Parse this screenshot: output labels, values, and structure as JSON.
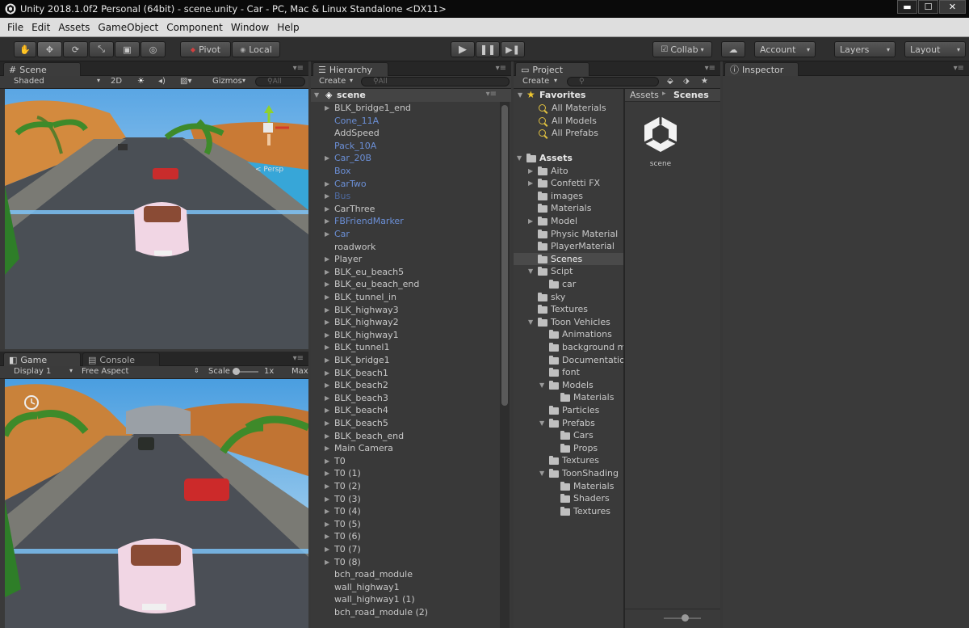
{
  "window": {
    "title": "Unity 2018.1.0f2 Personal (64bit) - scene.unity - Car - PC, Mac & Linux Standalone <DX11>"
  },
  "menu": [
    "File",
    "Edit",
    "Assets",
    "GameObject",
    "Component",
    "Window",
    "Help"
  ],
  "toolbar": {
    "pivot": "Pivot",
    "local": "Local",
    "collab": "Collab",
    "account": "Account",
    "layers": "Layers",
    "layout": "Layout"
  },
  "scene": {
    "tab": "Scene",
    "shading": "Shaded",
    "mode2d": "2D",
    "gizmos": "Gizmos",
    "search_placeholder": "All",
    "persp": "< Persp"
  },
  "game": {
    "tab": "Game",
    "console_tab": "Console",
    "display": "Display 1",
    "aspect": "Free Aspect",
    "scale_label": "Scale",
    "scale_value": "1x",
    "maximize": "Max"
  },
  "hierarchy": {
    "tab": "Hierarchy",
    "create": "Create",
    "search_placeholder": "All",
    "root": "scene",
    "items": [
      {
        "label": "BLK_bridge1_end",
        "arrow": true,
        "style": "normal"
      },
      {
        "label": "Cone_11A",
        "arrow": false,
        "style": "prefab"
      },
      {
        "label": "AddSpeed",
        "arrow": false,
        "style": "normal"
      },
      {
        "label": "Pack_10A",
        "arrow": false,
        "style": "prefab"
      },
      {
        "label": "Car_20B",
        "arrow": true,
        "style": "prefab"
      },
      {
        "label": "Box",
        "arrow": false,
        "style": "prefab"
      },
      {
        "label": "CarTwo",
        "arrow": true,
        "style": "prefab"
      },
      {
        "label": "Bus",
        "arrow": true,
        "style": "prefab-dim"
      },
      {
        "label": "CarThree",
        "arrow": true,
        "style": "normal"
      },
      {
        "label": "FBFriendMarker",
        "arrow": true,
        "style": "prefab"
      },
      {
        "label": "Car",
        "arrow": true,
        "style": "prefab"
      },
      {
        "label": "roadwork",
        "arrow": false,
        "style": "normal"
      },
      {
        "label": "Player",
        "arrow": true,
        "style": "normal"
      },
      {
        "label": "BLK_eu_beach5",
        "arrow": true,
        "style": "normal"
      },
      {
        "label": "BLK_eu_beach_end",
        "arrow": true,
        "style": "normal"
      },
      {
        "label": "BLK_tunnel_in",
        "arrow": true,
        "style": "normal"
      },
      {
        "label": "BLK_highway3",
        "arrow": true,
        "style": "normal"
      },
      {
        "label": "BLK_highway2",
        "arrow": true,
        "style": "normal"
      },
      {
        "label": "BLK_highway1",
        "arrow": true,
        "style": "normal"
      },
      {
        "label": "BLK_tunnel1",
        "arrow": true,
        "style": "normal"
      },
      {
        "label": "BLK_bridge1",
        "arrow": true,
        "style": "normal"
      },
      {
        "label": "BLK_beach1",
        "arrow": true,
        "style": "normal"
      },
      {
        "label": "BLK_beach2",
        "arrow": true,
        "style": "normal"
      },
      {
        "label": "BLK_beach3",
        "arrow": true,
        "style": "normal"
      },
      {
        "label": "BLK_beach4",
        "arrow": true,
        "style": "normal"
      },
      {
        "label": "BLK_beach5",
        "arrow": true,
        "style": "normal"
      },
      {
        "label": "BLK_beach_end",
        "arrow": true,
        "style": "normal"
      },
      {
        "label": "Main Camera",
        "arrow": true,
        "style": "normal"
      },
      {
        "label": "T0",
        "arrow": true,
        "style": "normal"
      },
      {
        "label": "T0 (1)",
        "arrow": true,
        "style": "normal"
      },
      {
        "label": "T0 (2)",
        "arrow": true,
        "style": "normal"
      },
      {
        "label": "T0 (3)",
        "arrow": true,
        "style": "normal"
      },
      {
        "label": "T0 (4)",
        "arrow": true,
        "style": "normal"
      },
      {
        "label": "T0 (5)",
        "arrow": true,
        "style": "normal"
      },
      {
        "label": "T0 (6)",
        "arrow": true,
        "style": "normal"
      },
      {
        "label": "T0 (7)",
        "arrow": true,
        "style": "normal"
      },
      {
        "label": "T0 (8)",
        "arrow": true,
        "style": "normal"
      },
      {
        "label": "bch_road_module",
        "arrow": false,
        "style": "normal"
      },
      {
        "label": "wall_highway1",
        "arrow": false,
        "style": "normal"
      },
      {
        "label": "wall_highway1 (1)",
        "arrow": false,
        "style": "normal"
      },
      {
        "label": "bch_road_module (2)",
        "arrow": false,
        "style": "normal"
      }
    ]
  },
  "project": {
    "tab": "Project",
    "create": "Create",
    "favorites": {
      "label": "Favorites",
      "items": [
        "All Materials",
        "All Models",
        "All Prefabs"
      ]
    },
    "tree": [
      {
        "label": "Assets",
        "depth": 0,
        "arrow": "open",
        "bold": true
      },
      {
        "label": "Aito",
        "depth": 1,
        "arrow": "closed"
      },
      {
        "label": "Confetti FX",
        "depth": 1,
        "arrow": "closed"
      },
      {
        "label": "images",
        "depth": 1,
        "arrow": "none"
      },
      {
        "label": "Materials",
        "depth": 1,
        "arrow": "none"
      },
      {
        "label": "Model",
        "depth": 1,
        "arrow": "closed"
      },
      {
        "label": "Physic Material",
        "depth": 1,
        "arrow": "none"
      },
      {
        "label": "PlayerMaterial",
        "depth": 1,
        "arrow": "none"
      },
      {
        "label": "Scenes",
        "depth": 1,
        "arrow": "none",
        "selected": true
      },
      {
        "label": "Scipt",
        "depth": 1,
        "arrow": "open"
      },
      {
        "label": "car",
        "depth": 2,
        "arrow": "none"
      },
      {
        "label": "sky",
        "depth": 1,
        "arrow": "none"
      },
      {
        "label": "Textures",
        "depth": 1,
        "arrow": "none"
      },
      {
        "label": "Toon Vehicles",
        "depth": 1,
        "arrow": "open"
      },
      {
        "label": "Animations",
        "depth": 2,
        "arrow": "none"
      },
      {
        "label": "background m",
        "depth": 2,
        "arrow": "none"
      },
      {
        "label": "Documentatio",
        "depth": 2,
        "arrow": "none"
      },
      {
        "label": "font",
        "depth": 2,
        "arrow": "none"
      },
      {
        "label": "Models",
        "depth": 2,
        "arrow": "open"
      },
      {
        "label": "Materials",
        "depth": 3,
        "arrow": "none"
      },
      {
        "label": "Particles",
        "depth": 2,
        "arrow": "none"
      },
      {
        "label": "Prefabs",
        "depth": 2,
        "arrow": "open"
      },
      {
        "label": "Cars",
        "depth": 3,
        "arrow": "none"
      },
      {
        "label": "Props",
        "depth": 3,
        "arrow": "none"
      },
      {
        "label": "Textures",
        "depth": 2,
        "arrow": "none"
      },
      {
        "label": "ToonShading",
        "depth": 2,
        "arrow": "open"
      },
      {
        "label": "Materials",
        "depth": 3,
        "arrow": "none"
      },
      {
        "label": "Shaders",
        "depth": 3,
        "arrow": "none"
      },
      {
        "label": "Textures",
        "depth": 3,
        "arrow": "none"
      }
    ],
    "breadcrumb": {
      "root": "Assets",
      "sep": "▸",
      "current": "Scenes"
    },
    "asset": {
      "name": "scene"
    }
  },
  "inspector": {
    "tab": "Inspector"
  },
  "colors": {
    "prefab": "#6b8fd6",
    "selection": "#4a4a4a",
    "accent_gold": "#e0c040"
  }
}
